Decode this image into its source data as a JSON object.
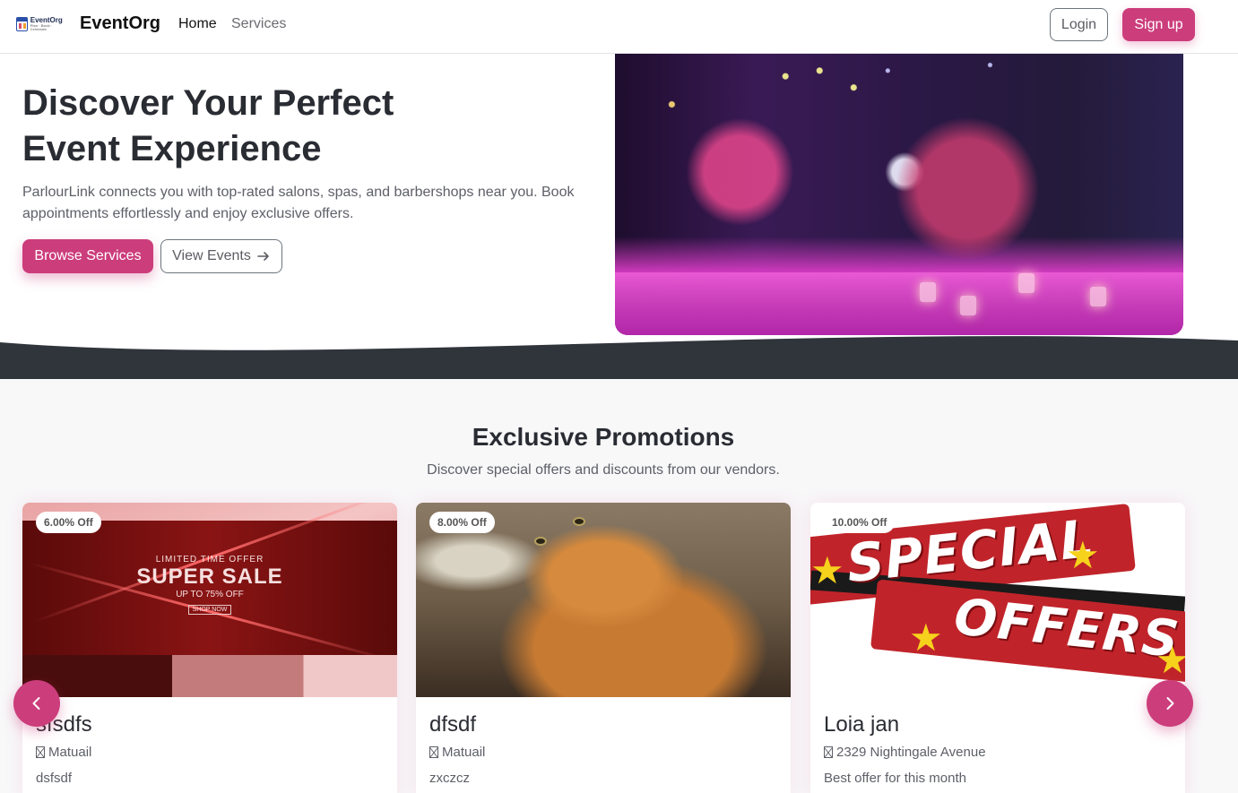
{
  "brand": {
    "name": "EventOrg",
    "logo_text": "EventOrg",
    "logo_tagline": "Plan · Book · Celebrate"
  },
  "nav": {
    "links": [
      {
        "label": "Home"
      },
      {
        "label": "Services"
      }
    ],
    "login_label": "Login",
    "signup_label": "Sign up"
  },
  "hero": {
    "title_line1": "Discover Your Perfect",
    "title_line2": "Event Experience",
    "description": "ParlourLink connects you with top-rated salons, spas, and barbershops near you. Book appointments effortlessly and enjoy exclusive offers.",
    "browse_label": "Browse Services",
    "events_label": "View Events",
    "events_icon": "arrow-right-icon"
  },
  "promotions": {
    "title": "Exclusive Promotions",
    "subtitle": "Discover special offers and discounts from our vendors.",
    "cards": [
      {
        "badge": "6.00% Off",
        "name": "sfsdfs",
        "location": "Matuail",
        "description": "dsfsdf",
        "image_text": {
          "l1": "LIMITED TIME OFFER",
          "l2": "SUPER SALE",
          "l3": "UP TO 75% OFF",
          "l4": "SHOP NOW"
        }
      },
      {
        "badge": "8.00% Off",
        "name": "dfsdf",
        "location": "Matuail",
        "description": "zxczcz"
      },
      {
        "badge": "10.00% Off",
        "name": "Loia jan",
        "location": "2329 Nightingale Avenue",
        "description": "Best offer for this month",
        "image_text": {
          "l1": "SPECIAL",
          "l2": "OFFERS"
        }
      }
    ]
  },
  "colors": {
    "accent": "#cc3d7c",
    "dark_band": "#30343b",
    "text_dark": "#2a2c33",
    "text_muted": "#5e6068"
  },
  "carousel": {
    "prev_icon": "chevron-left-icon",
    "next_icon": "chevron-right-icon"
  }
}
